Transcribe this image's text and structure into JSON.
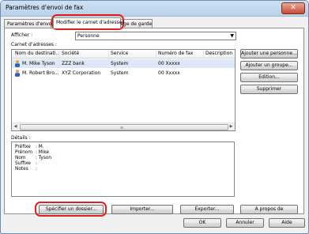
{
  "window": {
    "title": "Paramètres d'envoi de fax",
    "close_label": "✕"
  },
  "tabs": [
    {
      "label": "Paramètres d'envoi"
    },
    {
      "label": "Modifier le carnet d'adresses"
    },
    {
      "label": "Page de garde"
    }
  ],
  "afficher": {
    "label": "Afficher :",
    "value": "Personne"
  },
  "carnet": {
    "label": "Carnet d'adresses :"
  },
  "table": {
    "headers": [
      "Nom du destinati...",
      "Société",
      "Service",
      "Numéro de fax",
      "Description"
    ],
    "rows": [
      [
        "M. Mike Tyson",
        "ZZZ bank",
        "System",
        "00 Xxxxx",
        ""
      ],
      [
        "M. Robert Bro...",
        "XYZ Corporation",
        "System",
        "00 Xxxxx",
        ""
      ]
    ]
  },
  "side_buttons": {
    "add_person": "Ajouter une personne...",
    "add_group": "Ajouter un groupe...",
    "edit": "Edition...",
    "delete": "Supprimer"
  },
  "details": {
    "label": "Détails :",
    "lines": [
      {
        "key": "Préfixe",
        "value": ": M."
      },
      {
        "key": "Prénom",
        "value": ": Mike"
      },
      {
        "key": "Nom",
        "value": ": Tyson"
      },
      {
        "key": "Suffixe",
        "value": ":"
      },
      {
        "key": "Notes",
        "value": ":"
      }
    ]
  },
  "bottom_buttons": {
    "folder": "Spécifier un dossier...",
    "import": "Importer...",
    "export": "Exporter...",
    "about": "A propos de"
  },
  "footer_buttons": {
    "ok": "OK",
    "cancel": "Annuler",
    "help": "Aide"
  },
  "colors": {
    "highlight": "#e0201c",
    "selected_row": "#dde9f6",
    "title_bar": "#b9d1ea"
  }
}
